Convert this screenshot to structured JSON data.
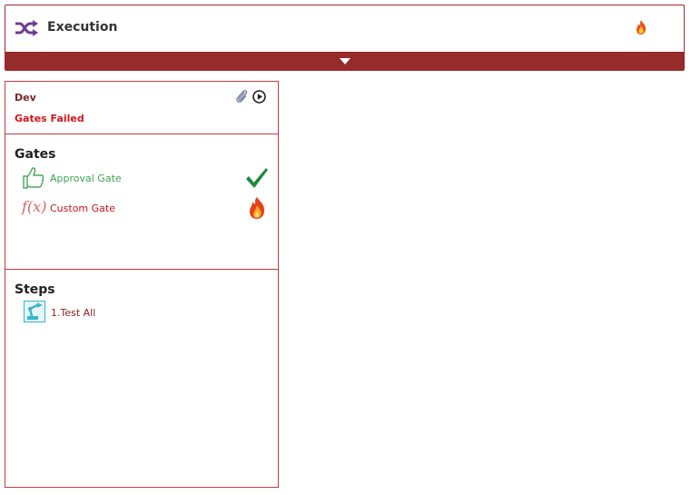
{
  "header": {
    "title": "Execution",
    "left_icon": "shuffle-icon",
    "right_icon": "fire-icon",
    "expand_icon": "caret-down-icon",
    "accent_color": "#972a2b"
  },
  "stage": {
    "name": "Dev",
    "status": "Gates Failed",
    "status_color": "#d0161d",
    "actions": [
      "paperclip-icon",
      "play-icon"
    ]
  },
  "gates": {
    "title": "Gates",
    "items": [
      {
        "label": "Approval Gate",
        "icon": "thumbs-up-icon",
        "status_icon": "checkmark-icon"
      },
      {
        "label": "Custom Gate",
        "icon": "function-icon",
        "icon_text": "f(x)",
        "status_icon": "fire-icon"
      }
    ]
  },
  "steps": {
    "title": "Steps",
    "items": [
      {
        "label": "1.Test All",
        "icon": "robot-arm-icon"
      }
    ]
  }
}
